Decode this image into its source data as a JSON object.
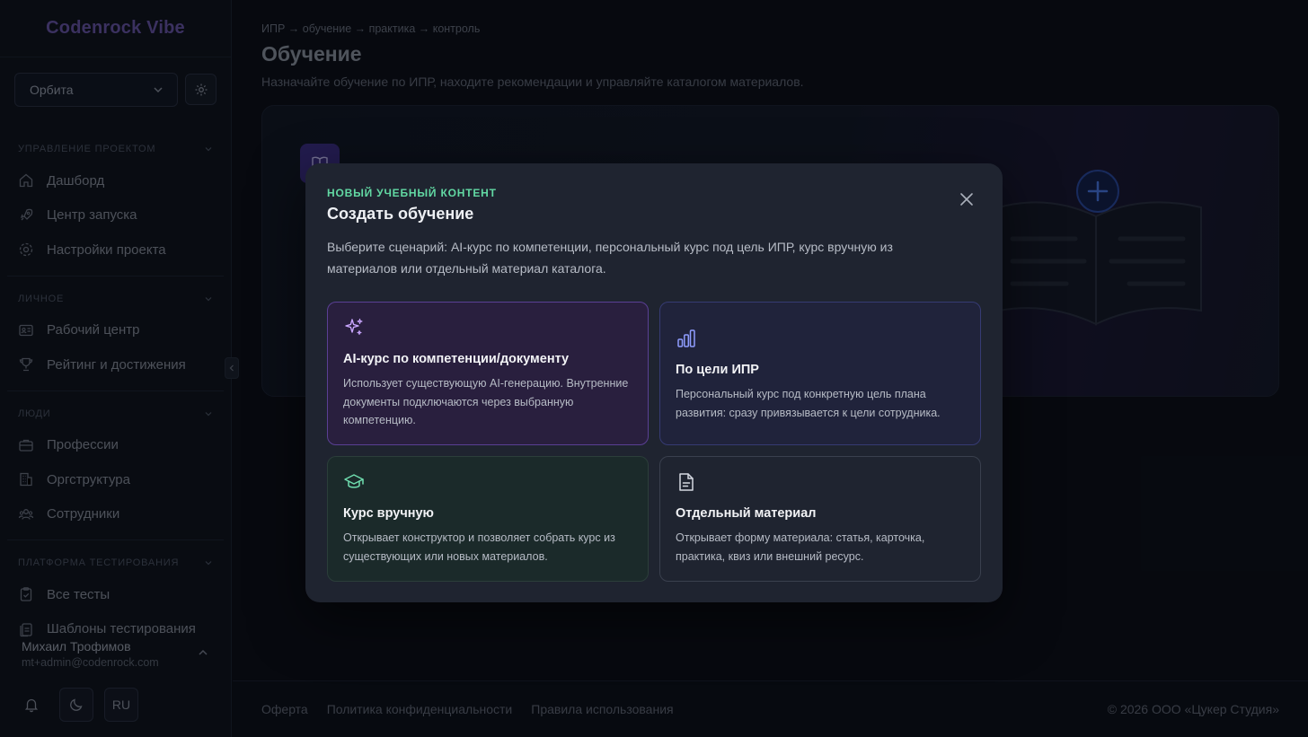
{
  "brand": "Codenrock Vibe",
  "project_select": {
    "value": "Орбита"
  },
  "sidebar": {
    "sections": [
      {
        "title": "Управление проектом",
        "items": [
          "Дашборд",
          "Центр запуска",
          "Настройки проекта"
        ]
      },
      {
        "title": "Личное",
        "items": [
          "Рабочий центр",
          "Рейтинг и достижения"
        ]
      },
      {
        "title": "Люди",
        "items": [
          "Профессии",
          "Оргструктура",
          "Сотрудники"
        ]
      },
      {
        "title": "Платформа тестирования",
        "items": [
          "Все тесты",
          "Шаблоны тестирования"
        ]
      }
    ],
    "user": {
      "name": "Михаил Трофимов",
      "email": "mt+admin@codenrock.com"
    },
    "language": "RU"
  },
  "page": {
    "breadcrumb": "ИПР → обучение → практика → контроль",
    "title": "Обучение",
    "subtitle": "Назначайте обучение по ИПР, находите рекомендации и управляйте каталогом материалов."
  },
  "footer": {
    "links": [
      "Оферта",
      "Политика конфиденциальности",
      "Правила использования"
    ],
    "copyright": "© 2026 ООО «Цукер Студия»"
  },
  "modal": {
    "eyebrow": "НОВЫЙ УЧЕБНЫЙ КОНТЕНТ",
    "title": "Создать обучение",
    "description": "Выберите сценарий: AI-курс по компетенции, персональный курс под цель ИПР, курс вручную из материалов или отдельный материал каталога.",
    "cards": [
      {
        "icon": "sparkles-icon",
        "title": "AI-курс по компетенции/документу",
        "description": "Использует существующую AI-генерацию. Внутренние документы подключаются через выбранную компетенцию."
      },
      {
        "icon": "bar-chart-icon",
        "title": "По цели ИПР",
        "description": "Персональный курс под конкретную цель плана развития: сразу привязывается к цели сотрудника."
      },
      {
        "icon": "graduation-cap-icon",
        "title": "Курс вручную",
        "description": "Открывает конструктор и позволяет собрать курс из существующих или новых материалов."
      },
      {
        "icon": "document-icon",
        "title": "Отдельный материал",
        "description": "Открывает форму материала: статья, карточка, практика, квиз или внешний ресурс."
      }
    ]
  },
  "colors": {
    "brand": "#6a56a8",
    "eyebrow": "#62d8a3",
    "ai_card_border": "#5a3f94",
    "goal_card_border": "#363b73"
  }
}
